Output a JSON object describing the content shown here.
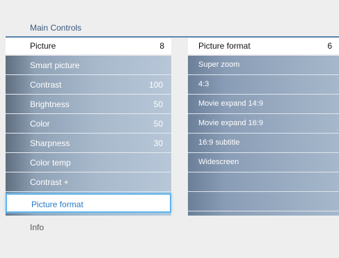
{
  "menu": {
    "title": "Main Controls",
    "left_header": {
      "label": "Picture",
      "value": "8"
    },
    "right_header": {
      "label": "Picture format",
      "value": "6"
    },
    "left_items": [
      {
        "label": "Smart picture",
        "value": ""
      },
      {
        "label": "Contrast",
        "value": "100"
      },
      {
        "label": "Brightness",
        "value": "50"
      },
      {
        "label": "Color",
        "value": "50"
      },
      {
        "label": "Sharpness",
        "value": "30"
      },
      {
        "label": "Color temp",
        "value": ""
      },
      {
        "label": "Contrast +",
        "value": ""
      },
      {
        "label": "Picture format",
        "value": ""
      }
    ],
    "selected_left_item": "Picture format",
    "right_items": [
      {
        "label": "Super zoom"
      },
      {
        "label": "4:3"
      },
      {
        "label": "Movie expand 14:9"
      },
      {
        "label": "Movie expand 16:9"
      },
      {
        "label": "16:9 subtitle"
      },
      {
        "label": "Widescreen"
      },
      {
        "label": ""
      },
      {
        "label": ""
      }
    ],
    "footer": "Info"
  },
  "colors": {
    "background": "#eeeeee",
    "title": "#3a5a80",
    "title_line": "#5b86b0",
    "selected_text": "#2b7bc5",
    "selected_border": "#64b3e8"
  }
}
